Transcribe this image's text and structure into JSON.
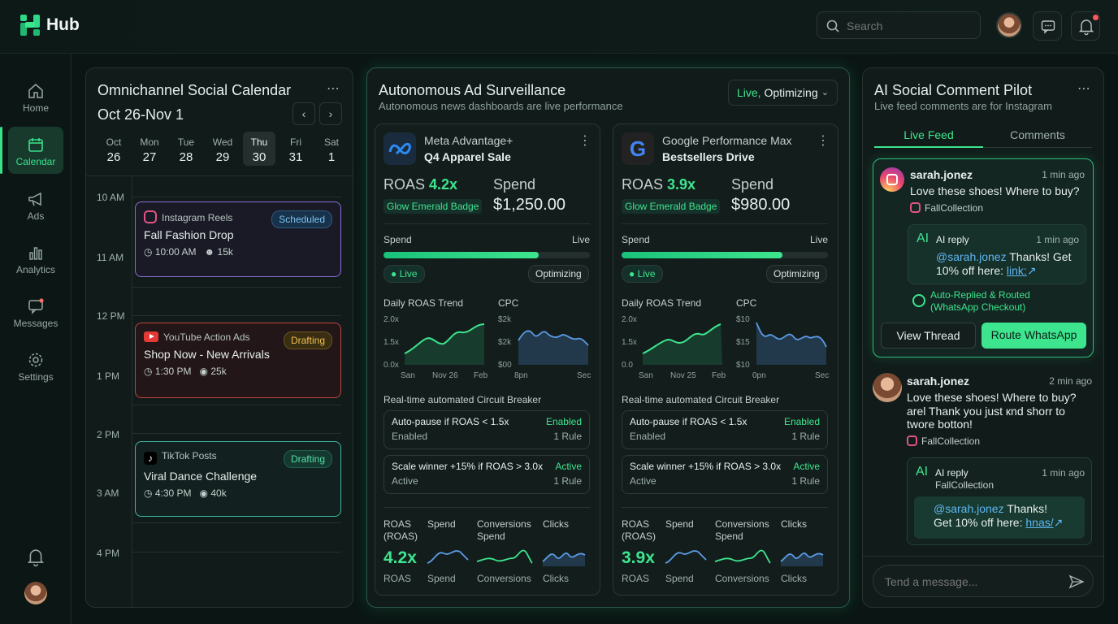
{
  "app": {
    "title": "Hub"
  },
  "search": {
    "placeholder": "Search"
  },
  "nav": {
    "items": [
      {
        "label": "Home"
      },
      {
        "label": "Calendar"
      },
      {
        "label": "Ads"
      },
      {
        "label": "Analytics"
      },
      {
        "label": "Messages"
      },
      {
        "label": "Settings"
      }
    ]
  },
  "calendar": {
    "title": "Omnichannel Social Calendar",
    "range": "Oct 26-Nov 1",
    "days": [
      {
        "dow": "Oct",
        "num": "26"
      },
      {
        "dow": "Mon",
        "num": "27"
      },
      {
        "dow": "Tue",
        "num": "28"
      },
      {
        "dow": "Wed",
        "num": "29"
      },
      {
        "dow": "Thu",
        "num": "30"
      },
      {
        "dow": "Fri",
        "num": "31"
      },
      {
        "dow": "Sat",
        "num": "1"
      }
    ],
    "times": [
      "10 AM",
      "11 AM",
      "12 PM",
      "1 PM",
      "2 PM",
      "3 AM",
      "4 PM"
    ],
    "events": [
      {
        "source": "Instagram Reels",
        "status": "Scheduled",
        "title": "Fall Fashion Drop",
        "time": "10:00 AM",
        "count": "15k"
      },
      {
        "source": "YouTube Action Ads",
        "status": "Drafting",
        "title": "Shop Now - New Arrivals",
        "time": "1:30 PM",
        "count": "25k"
      },
      {
        "source": "TikTok Posts",
        "status": "Drafting",
        "title": "Viral Dance Challenge",
        "time": "4:30 PM",
        "count": "40k"
      }
    ]
  },
  "ads": {
    "title": "Autonomous Ad Surveillance",
    "subtitle": "Autonomous news dashboards are live performance",
    "status_live": "Live,",
    "status_rest": " Optimizing",
    "campaigns": [
      {
        "platform": "Meta Advantage+",
        "name": "Q4 Apparel Sale",
        "roas_label": "ROAS",
        "roas": "4.2x",
        "badge": "Glow Emerald Badge",
        "spend_label": "Spend",
        "spend": "$1,250.00",
        "bar_label": "Spend",
        "bar_status": "Live",
        "spend_progress": 0.75,
        "live_pill": "Live",
        "opt_pill": "Optimizing",
        "trend_title": "Daily ROAS Trend",
        "trend_y": [
          "2.0x",
          "1.5x",
          "0.0x"
        ],
        "trend_x": [
          "San",
          "Nov 26",
          "Feb"
        ],
        "cpc_title": "CPC",
        "cpc_y": [
          "$2k",
          "$2k",
          "$00"
        ],
        "cpc_x": [
          "8pn",
          "Sec"
        ],
        "breaker_title": "Real-time automated Circuit Breaker",
        "rules": [
          {
            "name": "Auto-pause if ROAS < 1.5x",
            "status": "Enabled",
            "sub": "Enabled",
            "count": "1 Rule"
          },
          {
            "name": "Scale winner +15% if ROAS > 3.0x",
            "status": "Active",
            "sub": "Active",
            "count": "1 Rule"
          }
        ],
        "metrics": [
          {
            "head": "ROAS (ROAS)",
            "foot": "ROAS",
            "value": "4.2x"
          },
          {
            "head": "Spend",
            "foot": "Spend"
          },
          {
            "head": "Conversions Spend",
            "foot": "Conversions"
          },
          {
            "head": "Clicks",
            "foot": "Clicks"
          }
        ]
      },
      {
        "platform": "Google Performance Max",
        "name": "Bestsellers Drive",
        "roas_label": "ROAS",
        "roas": "3.9x",
        "badge": "Glow Emerald Badge",
        "spend_label": "Spend",
        "spend": "$980.00",
        "bar_label": "Spend",
        "bar_status": "Live",
        "spend_progress": 0.78,
        "live_pill": "Live",
        "opt_pill": "Optimizing",
        "trend_title": "Daily ROAS Trend",
        "trend_y": [
          "2.0x",
          "1.5x",
          "0.0"
        ],
        "trend_x": [
          "San",
          "Nov 25",
          "Feb"
        ],
        "cpc_title": "CPC",
        "cpc_y": [
          "$10",
          "$15",
          "$10"
        ],
        "cpc_x": [
          "0pn",
          "Sec"
        ],
        "breaker_title": "Real-time automated Circuit Breaker",
        "rules": [
          {
            "name": "Auto-pause if ROAS < 1.5x",
            "status": "Enabled",
            "sub": "Enabled",
            "count": "1 Rule"
          },
          {
            "name": "Scale winner +15% if ROAS > 3.0x",
            "status": "Active",
            "sub": "Active",
            "count": "1 Rule"
          }
        ],
        "metrics": [
          {
            "head": "ROAS (ROAS)",
            "foot": "ROAS",
            "value": "3.9x"
          },
          {
            "head": "Spend",
            "foot": "Spend"
          },
          {
            "head": "Conversions Spend",
            "foot": "Conversions"
          },
          {
            "head": "Clicks",
            "foot": "Clicks"
          }
        ]
      }
    ]
  },
  "pilot": {
    "title": "AI Social Comment Pilot",
    "subtitle": "Live feed comments are for Instagram",
    "tabs": [
      "Live Feed",
      "Comments"
    ],
    "comments": [
      {
        "user": "sarah.jonez",
        "time": "1 min ago",
        "text": "Love these shoes! Where to buy?",
        "account": "FallCollection",
        "reply_label": "AI reply",
        "reply_time": "1 min ago",
        "reply_mention": "@sarah.jonez",
        "reply_text": " Thanks! Get 10% off here: ",
        "reply_link": "link:",
        "routed": "Auto-Replied & Routed (WhatsApp Checkout)",
        "btn_view": "View Thread",
        "btn_route": "Route WhatsApp"
      },
      {
        "user": "sarah.jonez",
        "time": "2 min ago",
        "text": "Love these shoes! Where to buy? arel Thank you just кnd shorr to twore botton!",
        "account": "FallCollection",
        "reply_label": "AI reply",
        "reply_time": "1 min ago",
        "reply_sub": "FallCollection",
        "reply_mention": "@sarah.jonez",
        "reply_text": " Thanks! Get 10% off here: ",
        "reply_link": "hnas/"
      }
    ],
    "composer_placeholder": "Tend a message..."
  }
}
